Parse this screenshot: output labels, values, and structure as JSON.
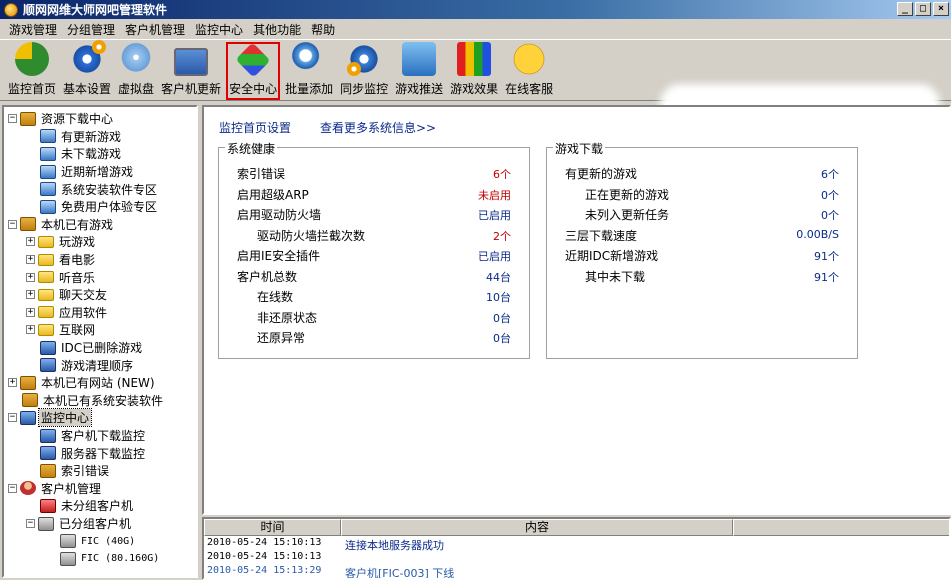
{
  "window": {
    "title": "顺网网维大师网吧管理软件",
    "buttons": [
      "_",
      "□",
      "×"
    ]
  },
  "menu": [
    "游戏管理",
    "分组管理",
    "客户机管理",
    "监控中心",
    "其他功能",
    "帮助"
  ],
  "toolbar": [
    {
      "label": "监控首页",
      "icon": "pie-chart-icon"
    },
    {
      "label": "基本设置",
      "icon": "gear-icon"
    },
    {
      "label": "虚拟盘",
      "icon": "disk-icon"
    },
    {
      "label": "客户机更新",
      "icon": "monitor-icon"
    },
    {
      "label": "安全中心",
      "icon": "security-cube-icon",
      "highlighted": true
    },
    {
      "label": "批量添加",
      "icon": "search-icon"
    },
    {
      "label": "同步监控",
      "icon": "sync-gear-icon"
    },
    {
      "label": "游戏推送",
      "icon": "push-icon"
    },
    {
      "label": "游戏效果",
      "icon": "effect-icon"
    },
    {
      "label": "在线客服",
      "icon": "smile-icon"
    }
  ],
  "tree": [
    {
      "label": "资源下载中心",
      "expander": "−"
    },
    {
      "label": "有更新游戏"
    },
    {
      "label": "未下载游戏"
    },
    {
      "label": "近期新增游戏"
    },
    {
      "label": "系统安装软件专区"
    },
    {
      "label": "免费用户体验专区"
    },
    {
      "label": "本机已有游戏",
      "expander": "−"
    },
    {
      "label": "玩游戏",
      "expander": "+"
    },
    {
      "label": "看电影",
      "expander": "+"
    },
    {
      "label": "听音乐",
      "expander": "+"
    },
    {
      "label": "聊天交友",
      "expander": "+"
    },
    {
      "label": "应用软件",
      "expander": "+"
    },
    {
      "label": "互联网",
      "expander": "+"
    },
    {
      "label": "IDC已删除游戏"
    },
    {
      "label": "游戏清理顺序"
    },
    {
      "label": "本机已有网站 (NEW)",
      "expander": "+"
    },
    {
      "label": "本机已有系统安装软件"
    },
    {
      "label": "监控中心",
      "expander": "−",
      "selected": true
    },
    {
      "label": "客户机下载监控"
    },
    {
      "label": "服务器下载监控"
    },
    {
      "label": "索引错误"
    },
    {
      "label": "客户机管理",
      "expander": "−"
    },
    {
      "label": "未分组客户机"
    },
    {
      "label": "已分组客户机",
      "expander": "−"
    },
    {
      "label": "FIC (40G)"
    },
    {
      "label": "FIC (80.160G)"
    }
  ],
  "main": {
    "links": [
      "监控首页设置",
      "查看更多系统信息>>"
    ],
    "health": {
      "title": "系统健康",
      "rows": [
        {
          "label": "索引错误",
          "value": "6个",
          "color": "red"
        },
        {
          "label": "启用超级ARP",
          "value": "未启用",
          "color": "red"
        },
        {
          "label": "启用驱动防火墙",
          "value": "已启用",
          "color": "blue"
        },
        {
          "label": "驱动防火墙拦截次数",
          "value": "2个",
          "color": "red"
        },
        {
          "label": "启用IE安全插件",
          "value": "已启用",
          "color": "blue"
        },
        {
          "label": "客户机总数",
          "value": "44台",
          "color": "blue"
        },
        {
          "label": "在线数",
          "value": "10台",
          "color": "blue"
        },
        {
          "label": "非还原状态",
          "value": "0台",
          "color": "blue"
        },
        {
          "label": "还原异常",
          "value": "0台",
          "color": "blue"
        }
      ]
    },
    "download": {
      "title": "游戏下载",
      "rows": [
        {
          "label": "有更新的游戏",
          "value": "6个"
        },
        {
          "label": "正在更新的游戏",
          "value": "0个"
        },
        {
          "label": "未列入更新任务",
          "value": "0个"
        },
        {
          "label": "三层下载速度",
          "value": "0.00B/S"
        },
        {
          "label": "近期IDC新增游戏",
          "value": "91个"
        },
        {
          "label": "其中未下载",
          "value": "91个"
        }
      ]
    }
  },
  "log": {
    "columns": [
      "时间",
      "内容"
    ],
    "rows": [
      {
        "time": "2010-05-24 15:10:13",
        "text": "连接本地服务器成功"
      },
      {
        "time": "2010-05-24 15:10:13",
        "text": ""
      },
      {
        "time": "2010-05-24 15:13:29",
        "text": "客户机[FIC-003] 下线"
      }
    ]
  }
}
